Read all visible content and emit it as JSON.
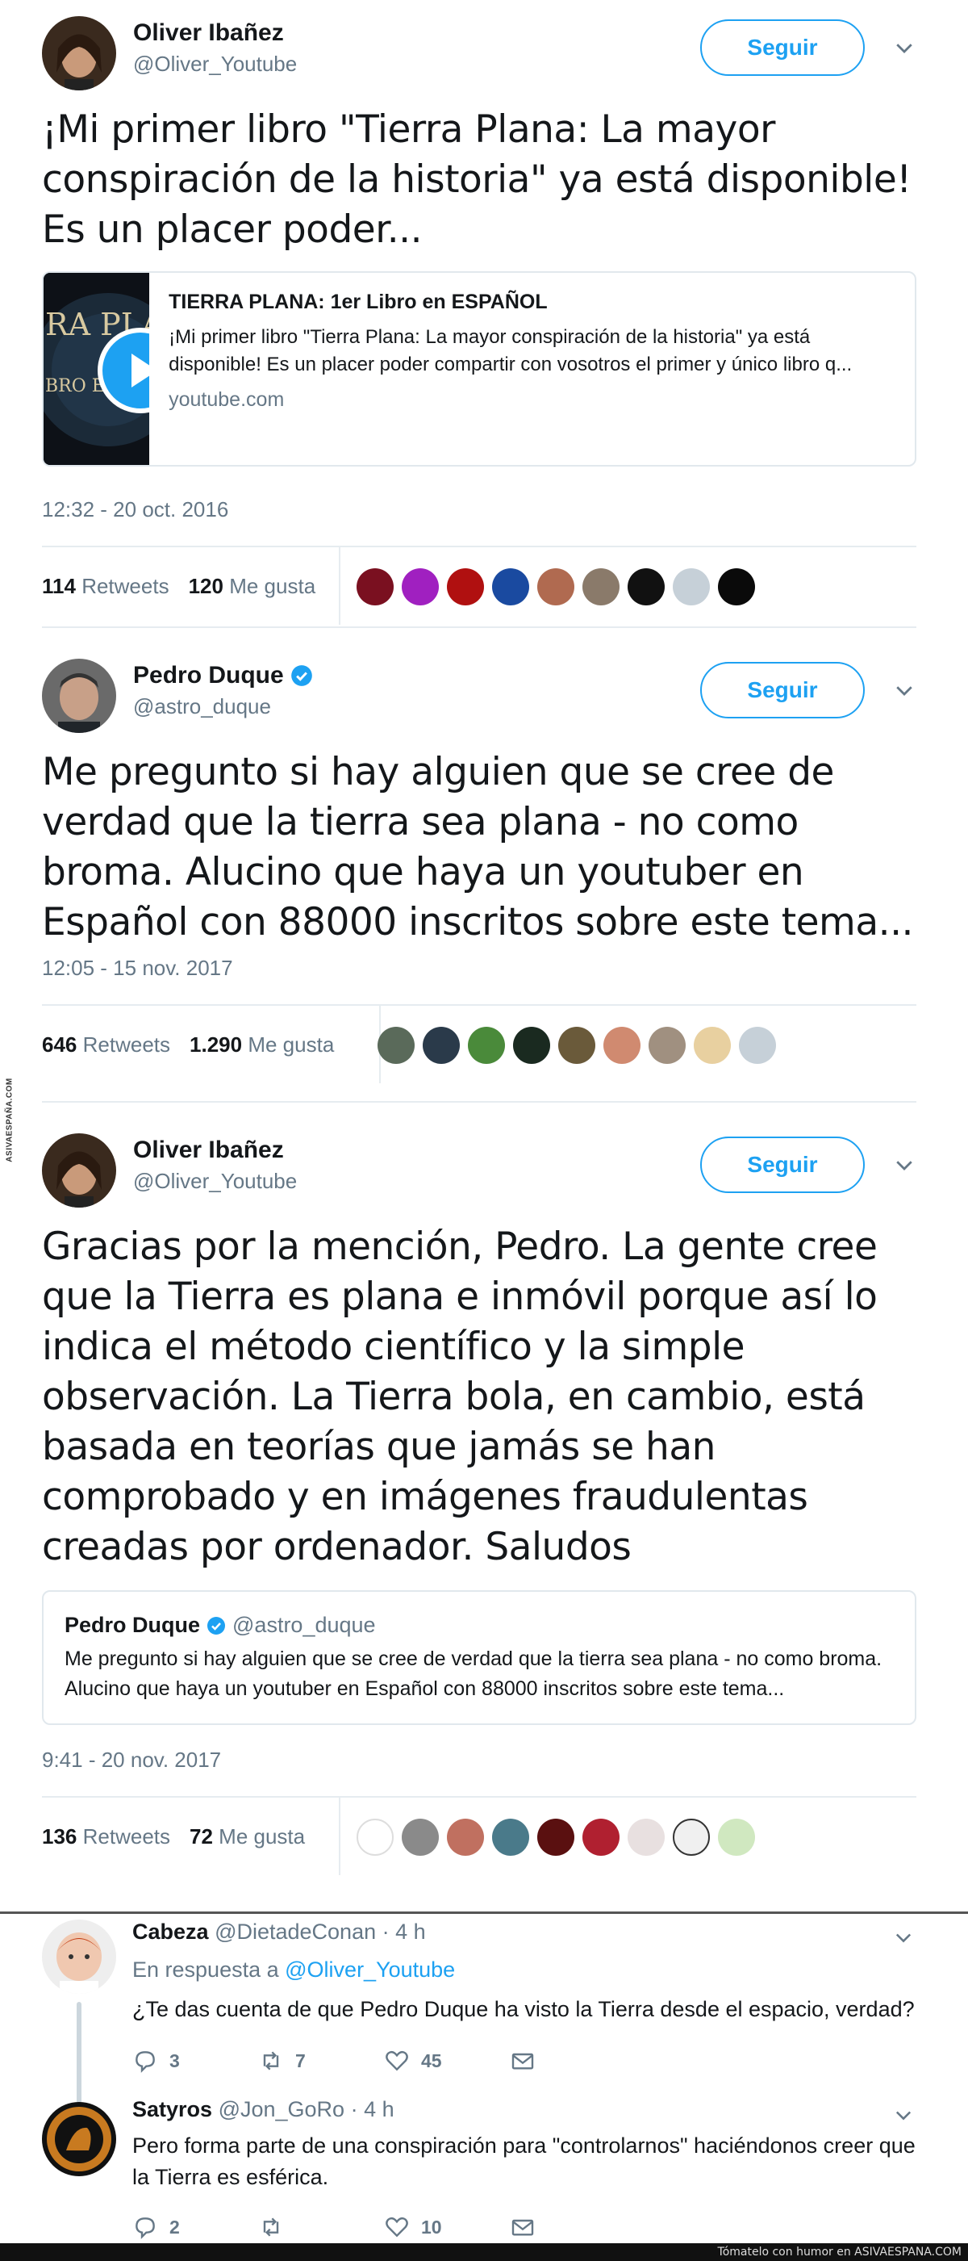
{
  "watermark": "ASIVAESPAÑA.COM",
  "colors": {
    "accent": "#1da1f2",
    "text": "#14171a",
    "muted": "#657786",
    "border": "#e1e8ed"
  },
  "tweet1": {
    "name": "Oliver Ibañez",
    "handle": "@Oliver_Youtube",
    "follow": "Seguir",
    "text": "¡Mi primer libro \"Tierra Plana: La mayor conspiración de la historia\" ya está disponible! Es un placer poder...",
    "card": {
      "thumb_text_1": "RA PLANA",
      "thumb_text_2": "BRO EN E",
      "title": "TIERRA PLANA: 1er Libro en ESPAÑOL",
      "description": "¡Mi primer libro \"Tierra Plana: La mayor conspiración de la historia\" ya está disponible! Es un placer poder compartir con vosotros el primer y único libro q...",
      "domain": "youtube.com"
    },
    "time": "12:32 - 20 oct. 2016",
    "retweets": "114",
    "retweets_label": "Retweets",
    "likes": "120",
    "likes_label": "Me gusta"
  },
  "tweet2": {
    "name": "Pedro Duque",
    "handle": "@astro_duque",
    "follow": "Seguir",
    "text": "Me pregunto si hay alguien que se cree de verdad que la tierra sea plana - no como broma.  Alucino que haya un youtuber en Español con 88000 inscritos sobre este tema...",
    "time": "12:05 - 15 nov. 2017",
    "retweets": "646",
    "retweets_label": "Retweets",
    "likes": "1.290",
    "likes_label": "Me gusta"
  },
  "tweet3": {
    "name": "Oliver Ibañez",
    "handle": "@Oliver_Youtube",
    "follow": "Seguir",
    "text": "Gracias por la mención, Pedro. La gente cree que la Tierra es plana e inmóvil porque así lo indica el método científico y la simple observación. La Tierra bola, en cambio, está basada en teorías que jamás se han comprobado y en imágenes fraudulentas creadas por ordenador. Saludos",
    "quote": {
      "name": "Pedro Duque",
      "handle": "@astro_duque",
      "text": "Me pregunto si hay alguien que se cree de verdad que la tierra sea plana - no como broma.  Alucino que haya un youtuber en Español con 88000 inscritos sobre este tema..."
    },
    "time": "9:41 - 20 nov. 2017",
    "retweets": "136",
    "retweets_label": "Retweets",
    "likes": "72",
    "likes_label": "Me gusta"
  },
  "reply1": {
    "name": "Cabeza",
    "handle": "@DietadeConan",
    "time": "· 4 h",
    "reply_prefix": "En respuesta a",
    "reply_to": "@Oliver_Youtube",
    "text": "¿Te das cuenta de que Pedro Duque ha visto la Tierra desde el espacio, verdad?",
    "replies": "3",
    "retweets": "7",
    "likes": "45"
  },
  "reply2": {
    "name": "Satyros",
    "handle": "@Jon_GoRo",
    "time": "· 4 h",
    "text": "Pero forma parte de una conspiración para \"controlarnos\" haciéndonos creer que la Tierra es esférica.",
    "replies": "2",
    "retweets": "",
    "likes": "10"
  },
  "footer": "Tómatelo con humor en ASIVAESPANA.COM"
}
